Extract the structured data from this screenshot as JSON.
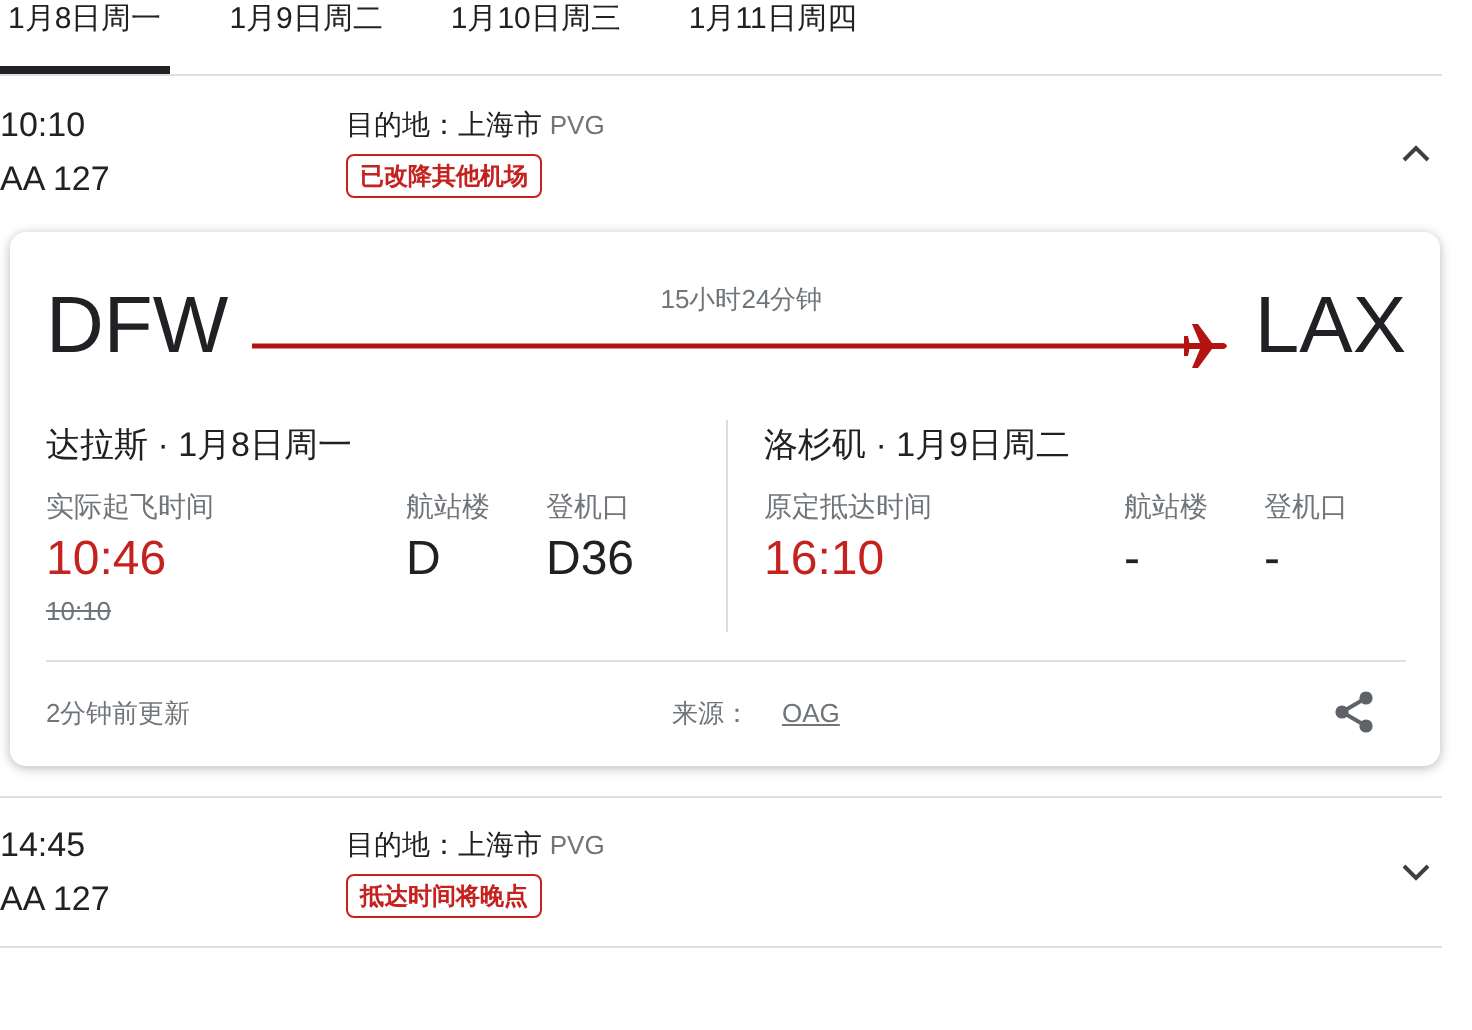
{
  "tabs": [
    {
      "label": "1月8日周一",
      "selected": true
    },
    {
      "label": "1月9日周二",
      "selected": false
    },
    {
      "label": "1月10日周三",
      "selected": false
    },
    {
      "label": "1月11日周四",
      "selected": false
    }
  ],
  "flights": [
    {
      "time": "10:10",
      "flight_no": "AA 127",
      "destination_label": "目的地：",
      "destination": "上海市",
      "destination_code": "PVG",
      "status": "已改降其他机场",
      "expanded": true,
      "details": {
        "origin_code": "DFW",
        "dest_code": "LAX",
        "duration": "15小时24分钟",
        "legs": [
          {
            "heading": "达拉斯 · 1月8日周一",
            "time_label": "实际起飞时间",
            "time": "10:46",
            "scheduled_time": "10:10",
            "terminal_label": "航站楼",
            "terminal": "D",
            "gate_label": "登机口",
            "gate": "D36"
          },
          {
            "heading": "洛杉矶 · 1月9日周二",
            "time_label": "原定抵达时间",
            "time": "16:10",
            "terminal_label": "航站楼",
            "terminal": "-",
            "gate_label": "登机口",
            "gate": "-"
          }
        ],
        "updated": "2分钟前更新",
        "source_label": "来源：",
        "source": "OAG"
      }
    },
    {
      "time": "14:45",
      "flight_no": "AA 127",
      "destination_label": "目的地：",
      "destination": "上海市",
      "destination_code": "PVG",
      "status": "抵达时间将晚点",
      "expanded": false
    }
  ]
}
